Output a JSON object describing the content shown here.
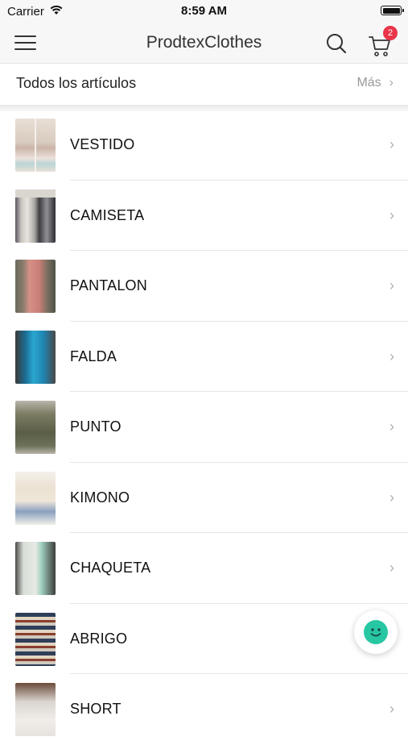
{
  "status_bar": {
    "carrier": "Carrier",
    "time": "8:59 AM"
  },
  "nav": {
    "title": "ProdtexClothes",
    "cart_badge": "2"
  },
  "section": {
    "title": "Todos los artículos",
    "more_label": "Más",
    "more_chevron": "›"
  },
  "categories": [
    {
      "label": "VESTIDO",
      "chevron": "›"
    },
    {
      "label": "CAMISETA",
      "chevron": "›"
    },
    {
      "label": "PANTALON",
      "chevron": "›"
    },
    {
      "label": "FALDA",
      "chevron": "›"
    },
    {
      "label": "PUNTO",
      "chevron": "›"
    },
    {
      "label": "KIMONO",
      "chevron": "›"
    },
    {
      "label": "CHAQUETA",
      "chevron": "›"
    },
    {
      "label": "ABRIGO",
      "chevron": "›"
    },
    {
      "label": "SHORT",
      "chevron": "›"
    }
  ],
  "colors": {
    "badge": "#e8354a",
    "chat_accent": "#27c7a4",
    "nav_bg": "#f7f7f7"
  },
  "icons": [
    "wifi-icon",
    "battery-icon",
    "hamburger-menu-icon",
    "search-icon",
    "cart-icon",
    "chevron-right-icon",
    "chat-smiley-icon"
  ]
}
